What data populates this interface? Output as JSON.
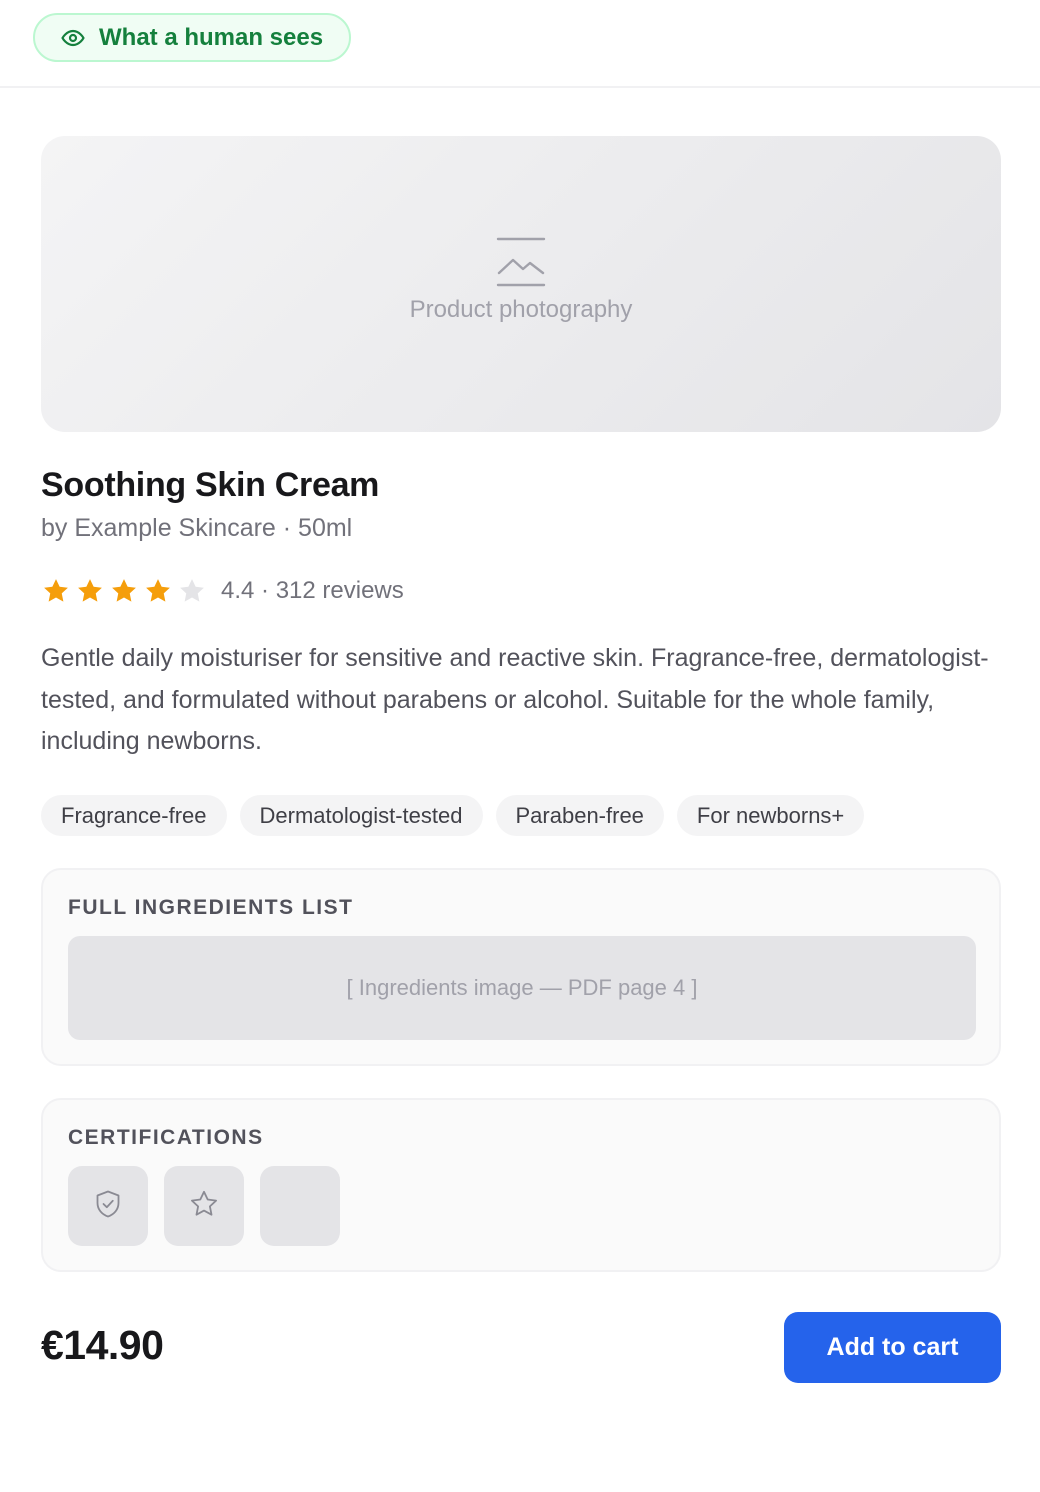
{
  "view_toggle": {
    "label": "What a human sees",
    "icon": "eye-icon",
    "color": "#15803d"
  },
  "product_image": {
    "placeholder_label": "Product photography",
    "icon": "image-icon"
  },
  "product": {
    "title": "Soothing Skin Cream",
    "subtitle": "by Example Skincare · 50ml",
    "rating": {
      "stars_filled": 4,
      "stars_total": 5,
      "text": "4.4 · 312 reviews",
      "star_color": "#f59e0b",
      "star_empty_color": "#e4e4e7"
    },
    "description": "Gentle daily moisturiser for sensitive and reactive skin. Fragrance-free, dermatologist-tested, and formulated without parabens or alcohol. Suitable for the whole family, including newborns.",
    "tags": [
      "Fragrance-free",
      "Dermatologist-tested",
      "Paraben-free",
      "For newborns+"
    ]
  },
  "ingredients": {
    "heading": "FULL INGREDIENTS LIST",
    "placeholder": "[ Ingredients image — PDF page 4 ]"
  },
  "certifications": {
    "heading": "CERTIFICATIONS",
    "badges": [
      {
        "icon": "shield-check-icon"
      },
      {
        "icon": "star-outline-icon"
      },
      {
        "icon": "blank"
      }
    ]
  },
  "purchase": {
    "price": "€14.90",
    "button_label": "Add to cart",
    "button_color": "#2563eb"
  }
}
